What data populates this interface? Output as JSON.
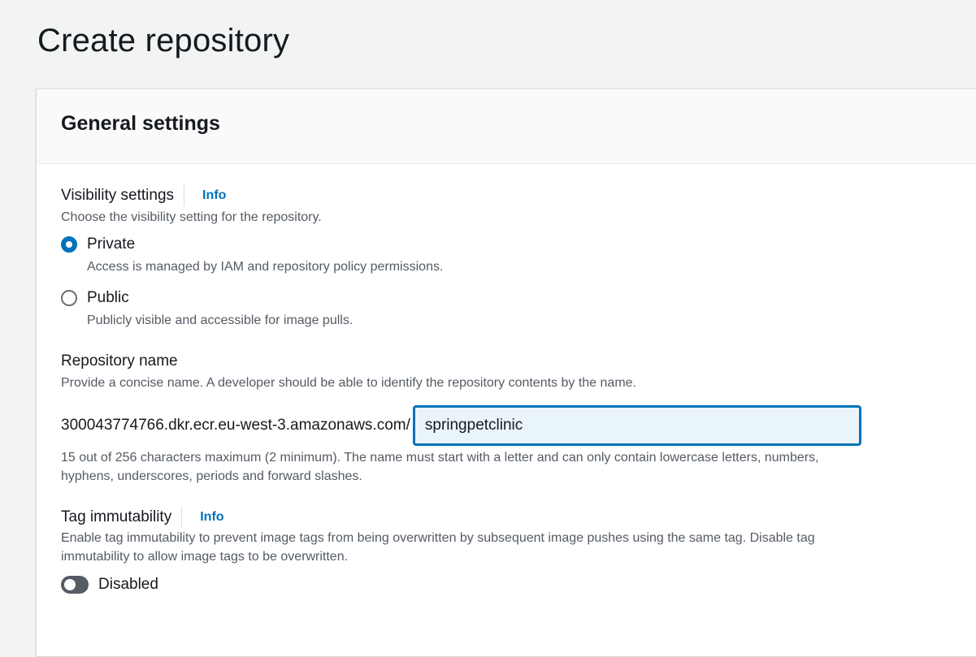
{
  "page": {
    "title": "Create repository"
  },
  "general_settings": {
    "title": "General settings",
    "visibility": {
      "label": "Visibility settings",
      "info": "Info",
      "description": "Choose the visibility setting for the repository.",
      "options": [
        {
          "label": "Private",
          "description": "Access is managed by IAM and repository policy permissions.",
          "selected": true
        },
        {
          "label": "Public",
          "description": "Publicly visible and accessible for image pulls.",
          "selected": false
        }
      ]
    },
    "repository_name": {
      "label": "Repository name",
      "description": "Provide a concise name. A developer should be able to identify the repository contents by the name.",
      "prefix": "300043774766.dkr.ecr.eu-west-3.amazonaws.com/",
      "value": "springpetclinic",
      "hint_line1": "15 out of 256 characters maximum (2 minimum). The name must start with a letter and can only contain lowercase letters, numbers,",
      "hint_line2": "hyphens, underscores, periods and forward slashes."
    },
    "tag_immutability": {
      "label": "Tag immutability",
      "info": "Info",
      "description_line1": "Enable tag immutability to prevent image tags from being overwritten by subsequent image pushes using the same tag. Disable tag",
      "description_line2": "immutability to allow image tags to be overwritten.",
      "toggle_label": "Disabled",
      "enabled": false
    }
  },
  "colors": {
    "accent": "#0073bb",
    "background": "#f2f3f3",
    "text_secondary": "#545b64"
  }
}
